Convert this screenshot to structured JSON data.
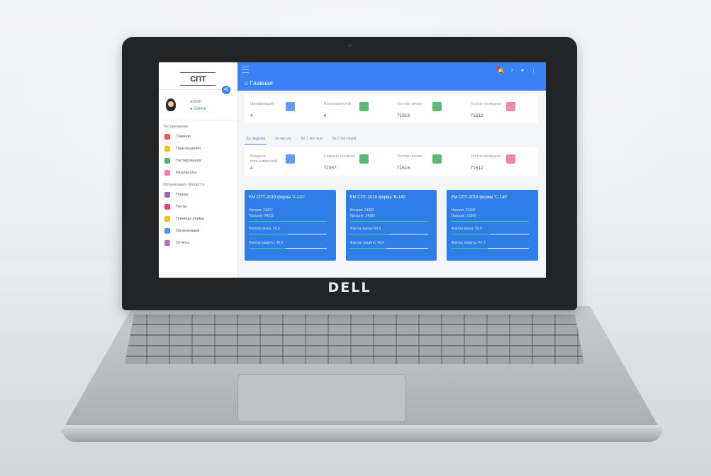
{
  "sidebar": {
    "logo_text": "СПТ",
    "user": {
      "name": "admin",
      "status": "Online",
      "fab": "45"
    },
    "section_testing": "Тестирование",
    "section_org": "Организация процесса",
    "items_testing": [
      {
        "label": "Главная",
        "icon": "home-icon",
        "color": "#e53935"
      },
      {
        "label": "Приглашения",
        "icon": "invite-icon",
        "color": "#f5b400"
      },
      {
        "label": "Тестирования",
        "icon": "test-icon",
        "color": "#34a853"
      },
      {
        "label": "Результаты",
        "icon": "results-icon",
        "color": "#ea6a9b"
      }
    ],
    "items_org": [
      {
        "label": "Планы",
        "icon": "plans-icon",
        "color": "#8e44ad"
      },
      {
        "label": "Тесты",
        "icon": "tests-icon",
        "color": "#e91e63"
      },
      {
        "label": "Границы нормы",
        "icon": "norms-icon",
        "color": "#f5b400"
      },
      {
        "label": "Организации",
        "icon": "org-icon",
        "color": "#3b82f6"
      },
      {
        "label": "Отчеты",
        "icon": "reports-icon",
        "color": "#9b59b6"
      }
    ]
  },
  "topbar": {
    "title": "Главная"
  },
  "stats_top": [
    {
      "label": "Организаций",
      "value": "4"
    },
    {
      "label": "Пользователей",
      "value": "4"
    },
    {
      "label": "Тестов начато",
      "value": "71619"
    },
    {
      "label": "Тестов пройдено",
      "value": "71612"
    }
  ],
  "tabs": [
    "За неделю",
    "За месяц",
    "За 3 месяца",
    "За 6 месяцев"
  ],
  "stats_period": [
    {
      "label": "Входило пользователей",
      "value": "4"
    },
    {
      "label": "Создано логинов",
      "value": "72357"
    },
    {
      "label": "Тестов начато",
      "value": "71616"
    },
    {
      "label": "Тестов пройдено",
      "value": "71612"
    }
  ],
  "cards": [
    {
      "title": "ЕМ СПТ-2019 форма 'А-110'",
      "started": "Начали: 24217",
      "passed": "Прошли: 24211",
      "risk": "Фактор риска: 50.0",
      "protect": "Фактор защиты: 46.6",
      "risk_level": 0.5,
      "protect_level": 0.47
    },
    {
      "title": "ЕМ СПТ-2019 форма 'В-140'",
      "started": "Начали: 24202",
      "passed": "Прошли: 24201",
      "risk": "Фактор риска: 50.0",
      "protect": "Фактор защиты: 46.6",
      "risk_level": 0.5,
      "protect_level": 0.47
    },
    {
      "title": "ЕМ СПТ-2019 форма 'С-140'",
      "started": "Начали: 23200",
      "passed": "Прошли: 23200",
      "risk": "Фактор риска: 50.0",
      "protect": "Фактор защиты: 47.3",
      "risk_level": 0.5,
      "protect_level": 0.47
    }
  ],
  "brand": "DELL"
}
